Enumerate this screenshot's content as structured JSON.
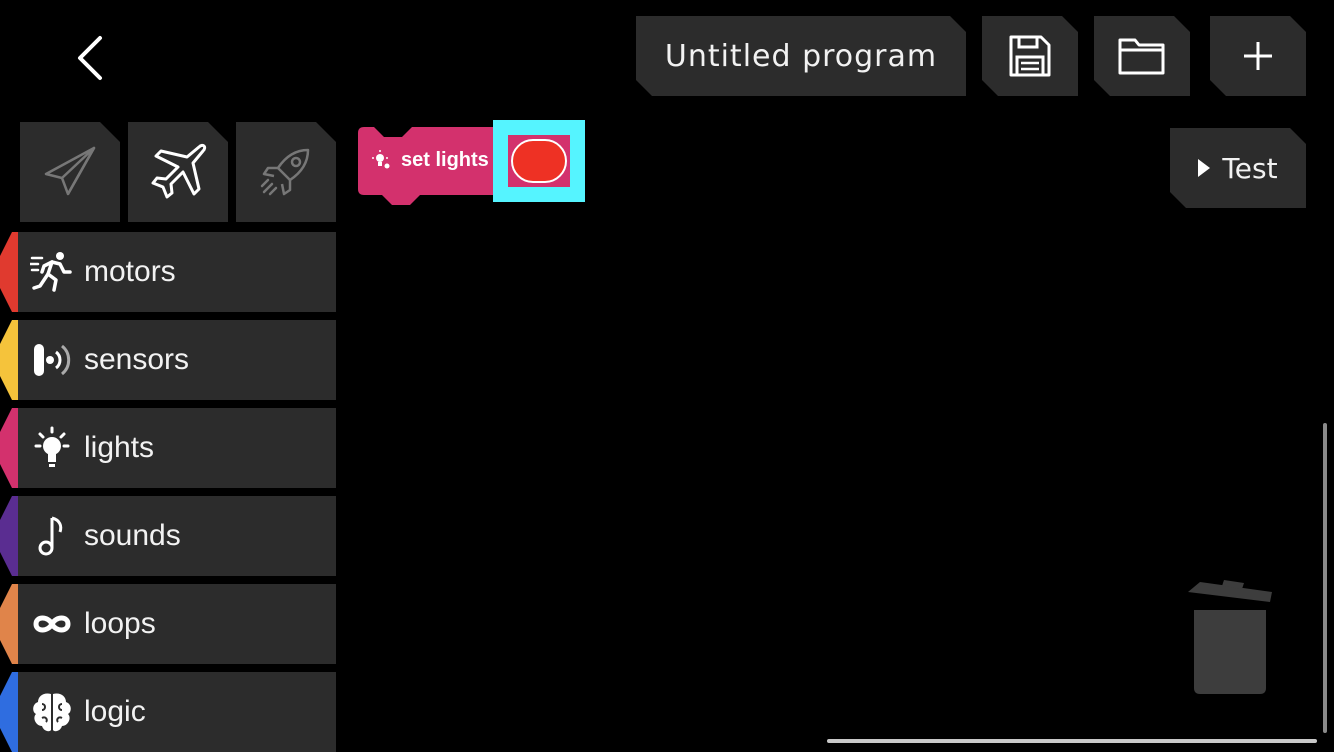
{
  "header": {
    "program_title": "Untitled program",
    "back_icon": "chevron-left-icon",
    "save_icon": "floppy-disk-icon",
    "open_icon": "folder-icon",
    "new_icon": "plus-icon"
  },
  "vehicle_tabs": [
    {
      "name": "paper-plane",
      "icon": "paper-plane-icon",
      "active": false
    },
    {
      "name": "airplane",
      "icon": "airplane-icon",
      "active": true
    },
    {
      "name": "rocket",
      "icon": "rocket-icon",
      "active": false
    }
  ],
  "categories": [
    {
      "label": "motors",
      "icon": "running-man-icon",
      "color": "#e03a2f"
    },
    {
      "label": "sensors",
      "icon": "sensor-icon",
      "color": "#f5c33b"
    },
    {
      "label": "lights",
      "icon": "lightbulb-icon",
      "color": "#d3316d"
    },
    {
      "label": "sounds",
      "icon": "music-note-icon",
      "color": "#5a2d91"
    },
    {
      "label": "loops",
      "icon": "infinity-icon",
      "color": "#e0844a"
    },
    {
      "label": "logic",
      "icon": "brain-icon",
      "color": "#2f6de0"
    }
  ],
  "canvas": {
    "block": {
      "label": "set lights",
      "icon": "lightbulb-icon",
      "block_color": "#d3316d",
      "selected_color": "#ee3124",
      "highlight_color": "#55f4ff"
    },
    "test_label": "Test",
    "trash_icon": "trash-can-icon"
  }
}
